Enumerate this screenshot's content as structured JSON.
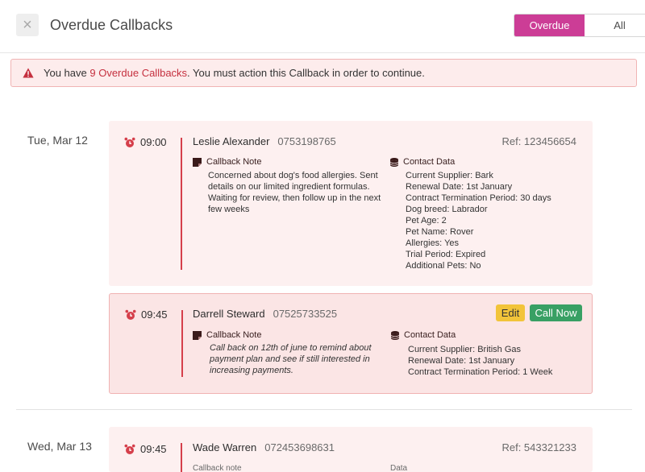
{
  "header": {
    "title": "Overdue Callbacks",
    "close_icon": "×",
    "filter": {
      "overdue": "Overdue",
      "all": "All"
    }
  },
  "alert": {
    "prefix": "You have",
    "count_link": "9 Overdue Callbacks",
    "suffix": ". You must action this Callback in order to continue."
  },
  "groups": [
    {
      "date": "Tue, Mar 12",
      "callbacks": [
        {
          "time": "09:00",
          "name": "Leslie Alexander",
          "phone": "0753198765",
          "ref": "Ref: 123456654",
          "note_title": "Callback Note",
          "note_lines": [
            "Concerned about dog's food allergies. Sent",
            "details on our limited ingredient formulas.",
            "Waiting for review, then follow up in the next",
            "few weeks"
          ],
          "contact_title": "Contact Data",
          "contact_lines": [
            "Current Supplier: Bark",
            "Renewal Date: 1st January",
            "Contract Termination Period: 30 days",
            "Dog breed: Labrador",
            "Pet Age: 2",
            "Pet Name: Rover",
            "Allergies: Yes",
            "Trial Period: Expired",
            "Additional Pets: No"
          ]
        },
        {
          "time": "09:45",
          "name": "Darrell Steward",
          "phone": "07525733525",
          "edit_label": "Edit",
          "call_label": "Call Now",
          "note_title": "Callback Note",
          "note_lines": [
            "Call back on 12th of june to remind about",
            "payment plan and see if still interested in",
            "increasing payments."
          ],
          "contact_title": "Contact Data",
          "contact_lines": [
            "Current Supplier: British Gas",
            "Renewal Date: 1st January",
            "Contract Termination Period: 1 Week"
          ]
        }
      ]
    },
    {
      "date": "Wed, Mar 13",
      "callbacks": [
        {
          "time": "09:45",
          "name": "Wade Warren",
          "phone": "072453698631",
          "ref": "Ref: 543321233",
          "note_title": "Callback note",
          "contact_title": "Data"
        }
      ]
    }
  ],
  "colors": {
    "accent": "#cc3d96",
    "danger": "#d53f4b",
    "edit": "#f2c43a",
    "call": "#38a064"
  },
  "icons": {
    "alert": "warning-triangle-icon",
    "time": "alarm-clock-icon",
    "note": "note-icon",
    "contact": "database-icon"
  }
}
